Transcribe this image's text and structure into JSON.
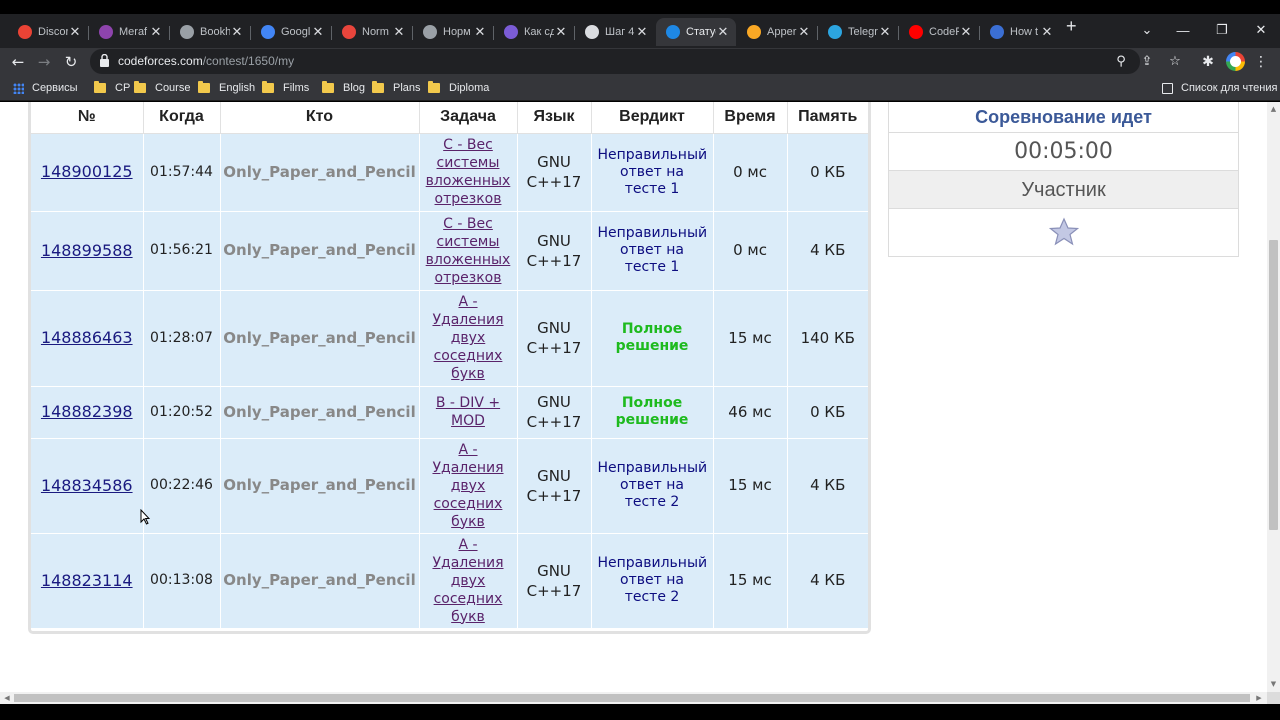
{
  "browser": {
    "tabs": [
      {
        "label": "Discor",
        "color": "#ea4335",
        "active": false
      },
      {
        "label": "Meraf",
        "color": "#8e44ad",
        "active": false
      },
      {
        "label": "Bookh",
        "color": "#9aa0a6",
        "active": false
      },
      {
        "label": "Googl",
        "color": "#4285f4",
        "active": false
      },
      {
        "label": "Norm",
        "color": "#e8453c",
        "active": false
      },
      {
        "label": "Норм",
        "color": "#9aa0a6",
        "active": false
      },
      {
        "label": "Как сд",
        "color": "#7b5cd6",
        "active": false
      },
      {
        "label": "Шаг 4",
        "color": "#dadce0",
        "active": false
      },
      {
        "label": "Статус",
        "color": "#1e88e5",
        "active": true
      },
      {
        "label": "Apper",
        "color": "#f9a825",
        "active": false
      },
      {
        "label": "Telegr",
        "color": "#2ca5e0",
        "active": false
      },
      {
        "label": "CodeF",
        "color": "#ff0000",
        "active": false
      },
      {
        "label": "How t",
        "color": "#3b6fd4",
        "active": false
      }
    ],
    "new_tab": "+",
    "address": {
      "host": "codeforces.com",
      "path": "/contest/1650/my"
    },
    "bookmarks": {
      "apps_label": "Сервисы",
      "folders": [
        "CP",
        "Course",
        "English",
        "Films",
        "Blog",
        "Plans",
        "Diploma"
      ],
      "reading_list": "Список для чтения"
    }
  },
  "table": {
    "headers": [
      "№",
      "Когда",
      "Кто",
      "Задача",
      "Язык",
      "Вердикт",
      "Время",
      "Память"
    ],
    "rows": [
      {
        "id": "148900125",
        "when": "01:57:44",
        "who": "Only_Paper_and_Pencil",
        "problem": "C - Вес системы вложенных отрезков",
        "lang": "GNU C++17",
        "verdict": "Неправильный ответ на тесте 1",
        "ok": false,
        "time": "0 мс",
        "memory": "0 КБ"
      },
      {
        "id": "148899588",
        "when": "01:56:21",
        "who": "Only_Paper_and_Pencil",
        "problem": "C - Вес системы вложенных отрезков",
        "lang": "GNU C++17",
        "verdict": "Неправильный ответ на тесте 1",
        "ok": false,
        "time": "0 мс",
        "memory": "4 КБ"
      },
      {
        "id": "148886463",
        "when": "01:28:07",
        "who": "Only_Paper_and_Pencil",
        "problem": "A - Удаления двух соседних букв",
        "lang": "GNU C++17",
        "verdict": "Полное решение",
        "ok": true,
        "time": "15 мс",
        "memory": "140 КБ"
      },
      {
        "id": "148882398",
        "when": "01:20:52",
        "who": "Only_Paper_and_Pencil",
        "problem": "B - DIV + MOD",
        "lang": "GNU C++17",
        "verdict": "Полное решение",
        "ok": true,
        "time": "46 мс",
        "memory": "0 КБ"
      },
      {
        "id": "148834586",
        "when": "00:22:46",
        "who": "Only_Paper_and_Pencil",
        "problem": "A - Удаления двух соседних букв",
        "lang": "GNU C++17",
        "verdict": "Неправильный ответ на тесте 2",
        "ok": false,
        "time": "15 мс",
        "memory": "4 КБ"
      },
      {
        "id": "148823114",
        "when": "00:13:08",
        "who": "Only_Paper_and_Pencil",
        "problem": "A - Удаления двух соседних букв",
        "lang": "GNU C++17",
        "verdict": "Неправильный ответ на тесте 2",
        "ok": false,
        "time": "15 мс",
        "memory": "4 КБ"
      }
    ]
  },
  "contest_box": {
    "status": "Соревнование идет",
    "timer": "00:05:00",
    "role": "Участник",
    "star_icon": "star-icon"
  },
  "colors": {
    "row_bg": "#dbecf9",
    "ok": "#1eba1e",
    "wrong": "#0d0d80",
    "status": "#3b5998"
  }
}
